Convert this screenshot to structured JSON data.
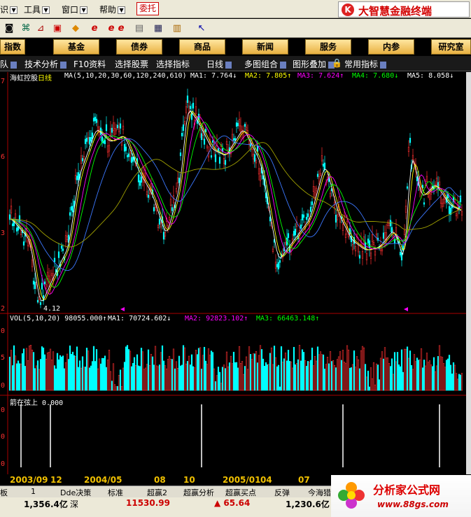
{
  "menubar": {
    "items": [
      "识",
      "工具",
      "窗口",
      "帮助"
    ],
    "entrust": "委托",
    "brand": "大智慧金融终端",
    "brand_logo": "K"
  },
  "toolbar": {
    "icons": [
      "binoculars-icon",
      "network-icon",
      "tag-icon",
      "diamond-icon",
      "ie-icon",
      "ie-icon",
      "ie-icon",
      "ie-icon",
      "copy-icon",
      "window-icon",
      "bars-icon",
      "pointer-help-icon"
    ]
  },
  "navbar": {
    "items": [
      "指数",
      "基金",
      "债券",
      "商品",
      "新闻",
      "服务",
      "内参",
      "研究室"
    ]
  },
  "subtool": {
    "items": [
      "队",
      "技术分析",
      "F10资料",
      "选择股票",
      "选择指标",
      "日线",
      "多图组合",
      "图形叠加",
      "常用指标"
    ]
  },
  "chart": {
    "stock": "海虹控股",
    "period": "日线",
    "ma_title": "MA(5,10,20,30,60,120,240,610)",
    "ma": [
      {
        "label": "MA1:",
        "value": "7.764↓",
        "color": "#ffffff"
      },
      {
        "label": "MA2:",
        "value": "7.805↑",
        "color": "#ffff00"
      },
      {
        "label": "MA3:",
        "value": "7.624↑",
        "color": "#ff00ff"
      },
      {
        "label": "MA4:",
        "value": "7.680↓",
        "color": "#00ff00"
      },
      {
        "label": "MA5:",
        "value": "8.058↓",
        "color": "#ffffff"
      }
    ],
    "low_label": "4.12",
    "price_axis": [
      "7",
      "6",
      "3",
      "2"
    ],
    "vol_title": "VOL(5,10,20)",
    "vol_value": "98055.000↑",
    "vol_ma": [
      {
        "label": "MA1:",
        "value": "70724.602↓",
        "color": "#ffffff"
      },
      {
        "label": "MA2:",
        "value": "92823.102↑",
        "color": "#ff00ff"
      },
      {
        "label": "MA3:",
        "value": "66463.148↑",
        "color": "#00ff00"
      }
    ],
    "vol_axis": [
      "0",
      "5",
      "0"
    ],
    "ind_title": "箭在弦上",
    "ind_value": "0.000",
    "ind_axis": [
      "0",
      "0",
      "0"
    ]
  },
  "datebar": {
    "dates": [
      "2003/09",
      "12",
      "2004/05",
      "08",
      "10",
      "2005/01",
      "04",
      "07"
    ]
  },
  "bottabs": {
    "items": [
      "板",
      "1",
      "Dde决策",
      "标准",
      "超赢2",
      "超赢分析",
      "超赢买点",
      "反弹",
      "今海猎"
    ]
  },
  "status": {
    "sh": "1,356.4亿",
    "sz_label": "深",
    "sz": "11530.99",
    "chg": "▲ 65.64",
    "amt": "1,230.6亿"
  },
  "ad": {
    "title": "分析家公式网",
    "url": "www.88gs.com"
  },
  "colors": {
    "up": "#ff3030",
    "down": "#00ffff",
    "accent": "#ffd700"
  }
}
